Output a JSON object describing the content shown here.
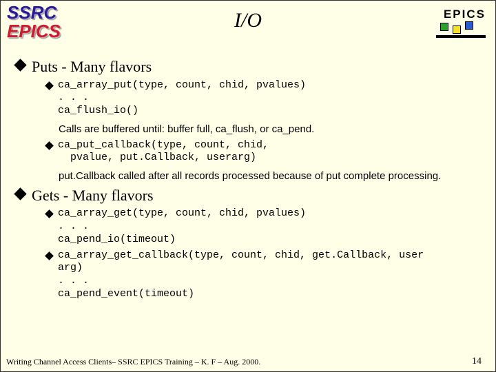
{
  "header": {
    "logo_top": "SSRC",
    "logo_bottom": "EPICS",
    "title": "I/O",
    "brand": "EPICS"
  },
  "sections": [
    {
      "heading": "Puts - Many flavors",
      "items": [
        {
          "code": "ca_array_put(type, count, chid, pvalues)\n. . .\nca_flush_io()",
          "note": "Calls are buffered until:  buffer full, ca_flush, or ca_pend."
        },
        {
          "code": "ca_put_callback(type, count, chid,\n  pvalue, put.Callback, userarg)",
          "note": "put.Callback called after all records processed because of put complete processing."
        }
      ]
    },
    {
      "heading": "Gets - Many flavors",
      "items": [
        {
          "code": "ca_array_get(type, count, chid, pvalues)\n. . .\nca_pend_io(timeout)",
          "note": ""
        },
        {
          "code": "ca_array_get_callback(type, count, chid, get.Callback, user\narg)\n. . .\nca_pend_event(timeout)",
          "note": ""
        }
      ]
    }
  ],
  "footer": {
    "text": "Writing Channel Access Clients– SSRC EPICS Training – K. F – Aug. 2000.",
    "page": "14"
  }
}
